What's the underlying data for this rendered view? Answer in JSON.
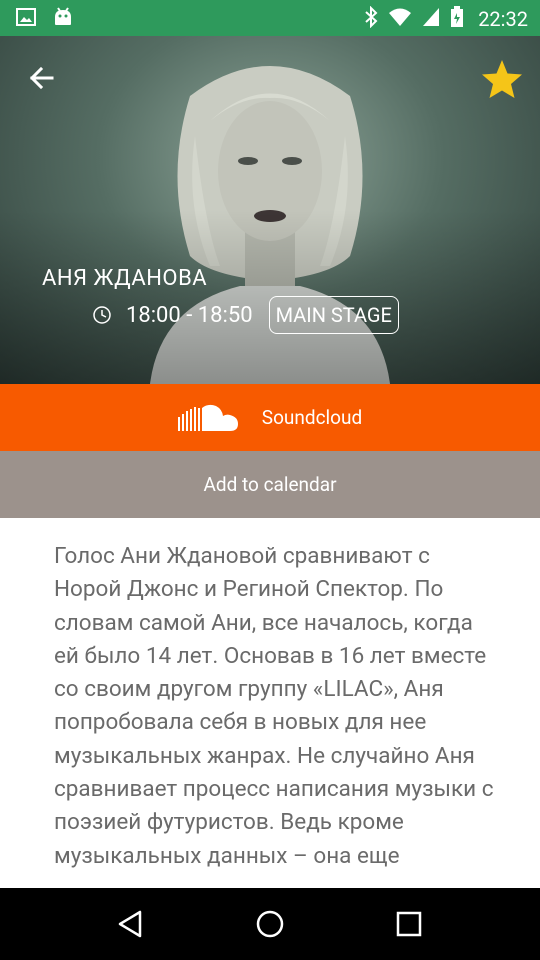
{
  "status_bar": {
    "time": "22:32",
    "icons": [
      "image-icon",
      "android-icon",
      "bluetooth-icon",
      "wifi-icon",
      "signal-icon",
      "battery-icon"
    ]
  },
  "hero": {
    "artist_name": "АНЯ ЖДАНОВА",
    "time_range": "18:00 - 18:50",
    "stage": "MAIN STAGE",
    "favorite_color": "#f5c518"
  },
  "actions": {
    "soundcloud_label": "Soundcloud",
    "calendar_label": "Add to calendar"
  },
  "description": {
    "text": "Голос Ани Ждановой сравнивают с Норой Джонс и Региной Спектор. По словам самой Ани, все началось, когда ей было 14 лет. Основав в 16 лет вместе со своим другом группу «LILAC», Аня попробовала себя в новых для нее музыкальных жанрах. Не случайно Аня сравнивает процесс написания музыки с поэзией футуристов. Ведь кроме музыкальных данных – она еще"
  },
  "colors": {
    "status_bar": "#2e9a5c",
    "soundcloud": "#f75a00",
    "calendar": "#9c928c",
    "text": "#6a6a6a"
  }
}
